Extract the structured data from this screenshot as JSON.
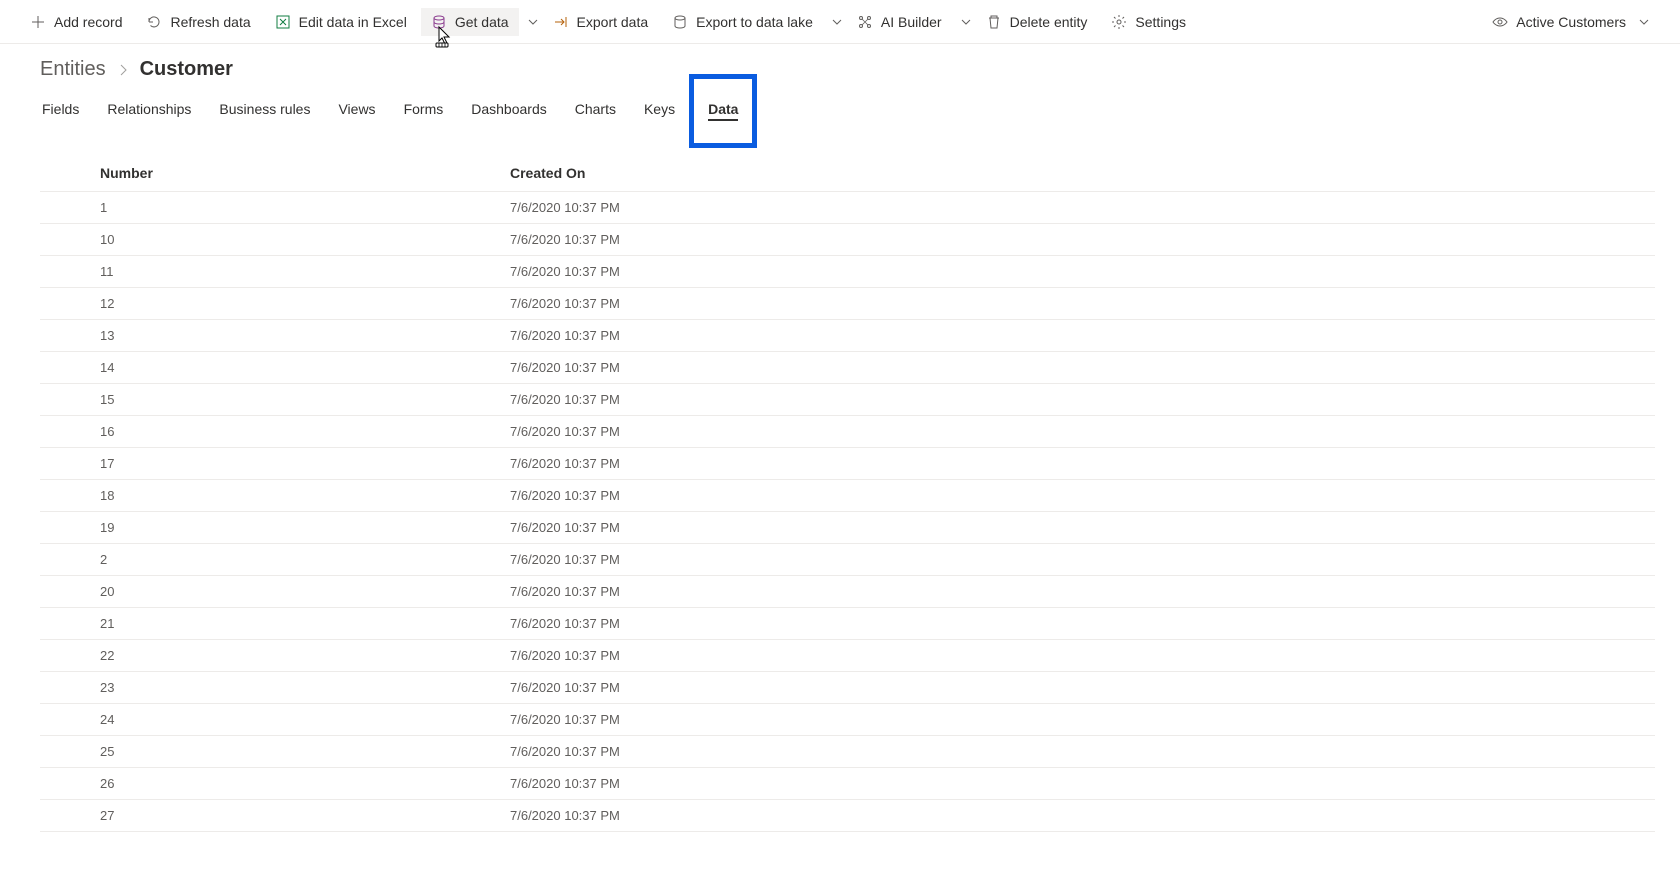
{
  "toolbar": {
    "add_record": "Add record",
    "refresh_data": "Refresh data",
    "edit_excel": "Edit data in Excel",
    "get_data": "Get data",
    "export_data": "Export data",
    "export_lake": "Export to data lake",
    "ai_builder": "AI Builder",
    "delete_entity": "Delete entity",
    "settings": "Settings",
    "view_selector": "Active Customers"
  },
  "breadcrumb": {
    "root": "Entities",
    "leaf": "Customer"
  },
  "tabs": {
    "fields": "Fields",
    "relationships": "Relationships",
    "business_rules": "Business rules",
    "views": "Views",
    "forms": "Forms",
    "dashboards": "Dashboards",
    "charts": "Charts",
    "keys": "Keys",
    "data": "Data"
  },
  "table": {
    "columns": {
      "number": "Number",
      "created_on": "Created On"
    },
    "rows": [
      {
        "number": "1",
        "created_on": "7/6/2020 10:37 PM"
      },
      {
        "number": "10",
        "created_on": "7/6/2020 10:37 PM"
      },
      {
        "number": "11",
        "created_on": "7/6/2020 10:37 PM"
      },
      {
        "number": "12",
        "created_on": "7/6/2020 10:37 PM"
      },
      {
        "number": "13",
        "created_on": "7/6/2020 10:37 PM"
      },
      {
        "number": "14",
        "created_on": "7/6/2020 10:37 PM"
      },
      {
        "number": "15",
        "created_on": "7/6/2020 10:37 PM"
      },
      {
        "number": "16",
        "created_on": "7/6/2020 10:37 PM"
      },
      {
        "number": "17",
        "created_on": "7/6/2020 10:37 PM"
      },
      {
        "number": "18",
        "created_on": "7/6/2020 10:37 PM"
      },
      {
        "number": "19",
        "created_on": "7/6/2020 10:37 PM"
      },
      {
        "number": "2",
        "created_on": "7/6/2020 10:37 PM"
      },
      {
        "number": "20",
        "created_on": "7/6/2020 10:37 PM"
      },
      {
        "number": "21",
        "created_on": "7/6/2020 10:37 PM"
      },
      {
        "number": "22",
        "created_on": "7/6/2020 10:37 PM"
      },
      {
        "number": "23",
        "created_on": "7/6/2020 10:37 PM"
      },
      {
        "number": "24",
        "created_on": "7/6/2020 10:37 PM"
      },
      {
        "number": "25",
        "created_on": "7/6/2020 10:37 PM"
      },
      {
        "number": "26",
        "created_on": "7/6/2020 10:37 PM"
      },
      {
        "number": "27",
        "created_on": "7/6/2020 10:37 PM"
      }
    ]
  }
}
